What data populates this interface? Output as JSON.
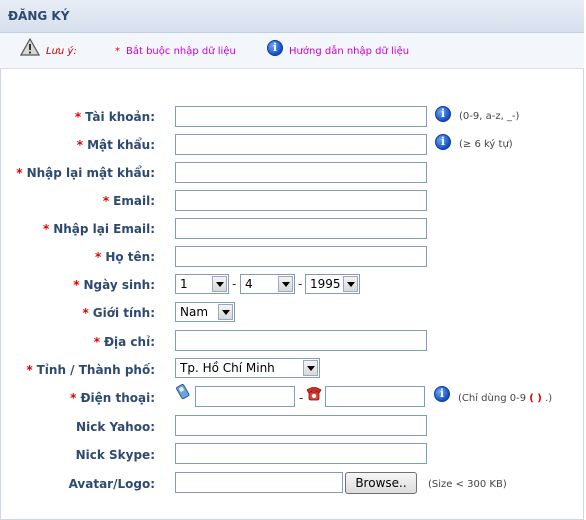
{
  "header": {
    "title": "ĐĂNG KÝ"
  },
  "note": {
    "label": "Lưu ý:",
    "required_star": "*",
    "required_text": "Bắt buộc nhập dữ liệu",
    "help_text": "Hướng dẫn nhập dữ liệu"
  },
  "form": {
    "required_star": "*",
    "account_label": "Tài khoản:",
    "account_hint": "(0-9, a-z, _-)",
    "password_label": "Mật khẩu:",
    "password_hint": "(≥ 6 ký tự)",
    "confirm_password_label": "Nhập lại mật khẩu:",
    "email_label": "Email:",
    "confirm_email_label": "Nhập lại Email:",
    "fullname_label": "Họ tên:",
    "birthday_label": "Ngày sinh:",
    "birthday_day": "1",
    "birthday_month": "4",
    "birthday_year": "1995",
    "date_separator": "-",
    "gender_label": "Giới tính:",
    "gender_value": "Nam",
    "address_label": "Địa chỉ:",
    "city_label": "Tỉnh / Thành phố:",
    "city_value": "Tp. Hồ Chí Minh",
    "phone_label": "Điện thoại:",
    "phone_hint_prefix": "(Chỉ dùng 0-9",
    "phone_hint_symbols": "( )",
    "phone_hint_suffix": ".)",
    "yahoo_label": "Nick Yahoo:",
    "skype_label": "Nick Skype:",
    "avatar_label": "Avatar/Logo:",
    "browse_label": "Browse..",
    "avatar_hint": "(Size < 300 KB)"
  },
  "colors": {
    "label": "#2e4a70",
    "required": "#e00000",
    "note": "#cc00cc"
  }
}
